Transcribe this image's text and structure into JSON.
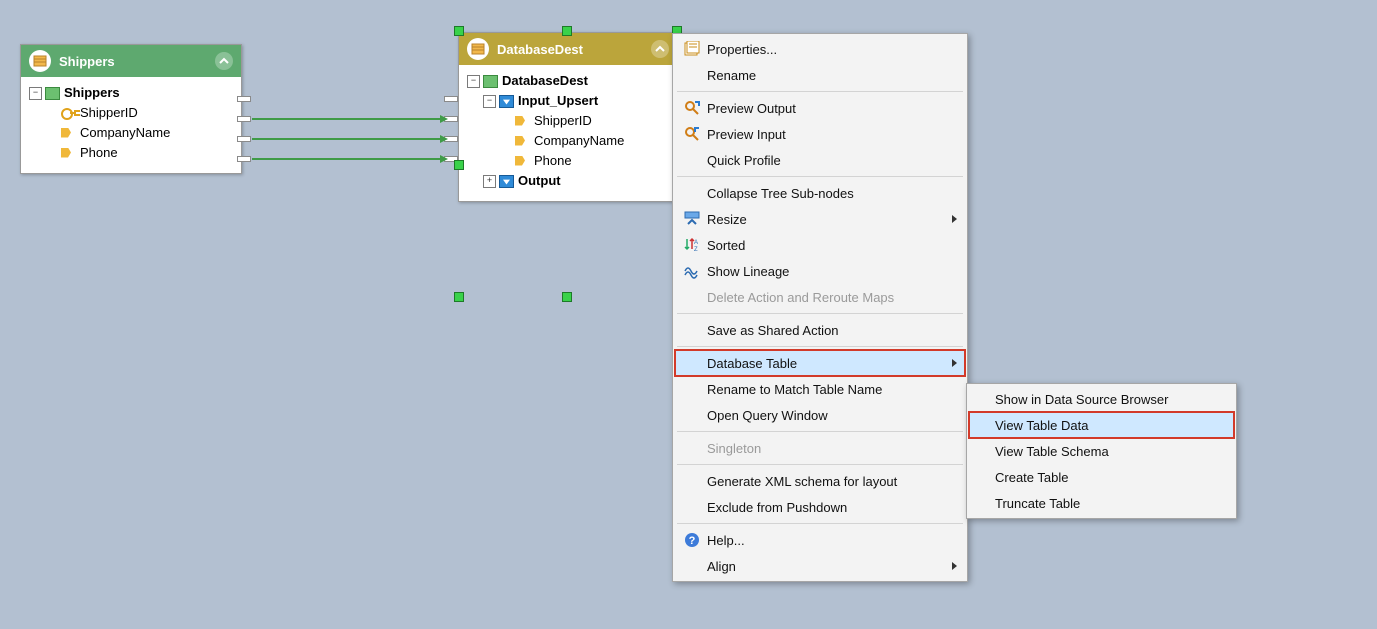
{
  "shippers_node": {
    "title": "Shippers",
    "root": "Shippers",
    "fields": [
      "ShipperID",
      "CompanyName",
      "Phone"
    ]
  },
  "dest_node": {
    "title": "DatabaseDest",
    "root": "DatabaseDest",
    "input_label": "Input_Upsert",
    "fields": [
      "ShipperID",
      "CompanyName",
      "Phone"
    ],
    "output_label": "Output"
  },
  "context_menu": {
    "properties": "Properties...",
    "rename": "Rename",
    "preview_output": "Preview Output",
    "preview_input": "Preview Input",
    "quick_profile": "Quick Profile",
    "collapse": "Collapse Tree Sub-nodes",
    "resize": "Resize",
    "sorted": "Sorted",
    "show_lineage": "Show Lineage",
    "delete_action": "Delete Action and Reroute Maps",
    "save_shared": "Save as Shared Action",
    "database_table": "Database Table",
    "rename_match": "Rename to Match Table Name",
    "open_query": "Open Query Window",
    "singleton": "Singleton",
    "gen_xml": "Generate XML schema for layout",
    "exclude_pushdown": "Exclude from Pushdown",
    "help": "Help...",
    "align": "Align"
  },
  "submenu": {
    "show_browser": "Show in Data Source Browser",
    "view_data": "View Table Data",
    "view_schema": "View Table Schema",
    "create": "Create Table",
    "truncate": "Truncate Table"
  }
}
